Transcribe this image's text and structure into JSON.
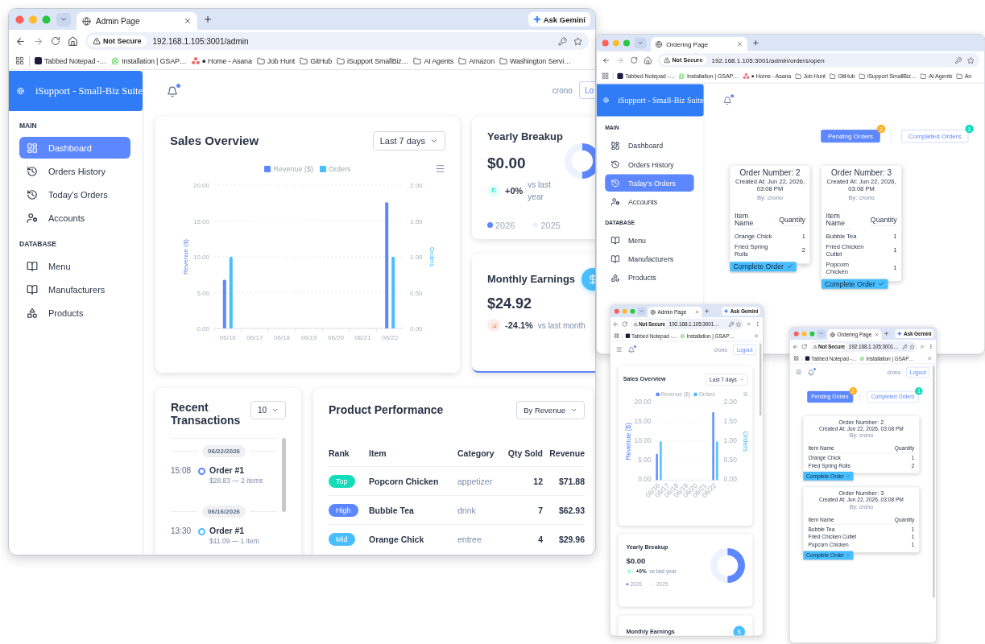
{
  "admin_window": {
    "browser": {
      "tab_title": "Admin Page",
      "assistant": "Ask Gemini",
      "security": "Not Secure",
      "url": "192.168.1.105:3001/admin",
      "bookmarks": [
        {
          "label": "Tabbed Notepad -…",
          "kind": "notepad"
        },
        {
          "label": "Installation | GSAP…",
          "kind": "gsap"
        },
        {
          "label": "● Home - Asana",
          "kind": "asana"
        },
        {
          "label": "Job Hunt",
          "kind": "folder"
        },
        {
          "label": "GitHub",
          "kind": "folder"
        },
        {
          "label": "iSupport SmallBiz…",
          "kind": "folder"
        },
        {
          "label": "AI Agents",
          "kind": "folder"
        },
        {
          "label": "Amazon",
          "kind": "folder"
        },
        {
          "label": "Washington Servi…",
          "kind": "folder"
        }
      ]
    },
    "sidebar": {
      "brand": "iSupport - Small-Biz Suite",
      "sections": [
        {
          "title": "MAIN",
          "items": [
            {
              "label": "Dashboard",
              "kind": "dashboard",
              "selected": true
            },
            {
              "label": "Orders History",
              "kind": "history",
              "selected": false
            },
            {
              "label": "Today's Orders",
              "kind": "history",
              "selected": false
            },
            {
              "label": "Accounts",
              "kind": "accounts",
              "selected": false
            }
          ]
        },
        {
          "title": "DATABASE",
          "items": [
            {
              "label": "Menu",
              "kind": "book",
              "selected": false
            },
            {
              "label": "Manufacturers",
              "kind": "book",
              "selected": false
            },
            {
              "label": "Products",
              "kind": "shapes",
              "selected": false
            }
          ]
        }
      ]
    },
    "header": {
      "user": "crono",
      "logout": "Lo"
    },
    "sales_overview": {
      "title": "Sales Overview",
      "range": "Last 7 days",
      "chart_data": {
        "type": "bar",
        "grid": true,
        "categories": [
          "06/16",
          "06/17",
          "06/18",
          "06/19",
          "06/20",
          "06/21",
          "06/22"
        ],
        "series": [
          {
            "name": "Revenue ($)",
            "color": "#5d87ff",
            "values": [
              6.8,
              0,
              0,
              0,
              0,
              0,
              17.6
            ]
          },
          {
            "name": "Orders",
            "color": "#49beff",
            "axis": "y2",
            "values": [
              1,
              0,
              0,
              0,
              0,
              0,
              1
            ]
          }
        ],
        "ylabel": "Revenue ($)",
        "ylim": [
          0,
          20
        ],
        "yticks": [
          {
            "value": 0,
            "label": "0.00"
          },
          {
            "value": 5,
            "label": "5.00"
          },
          {
            "value": 10,
            "label": "10.00"
          },
          {
            "value": 15,
            "label": "15.00"
          },
          {
            "value": 20,
            "label": "20.00"
          }
        ],
        "y2label": "Orders",
        "y2lim": [
          0,
          2
        ],
        "y2ticks": [
          {
            "value": 0,
            "label": "0.00"
          },
          {
            "value": 0.5,
            "label": "0.50"
          },
          {
            "value": 1,
            "label": "1.00"
          },
          {
            "value": 1.5,
            "label": "1.50"
          },
          {
            "value": 2,
            "label": "2.00"
          }
        ]
      }
    },
    "yearly_breakup": {
      "title": "Yearly Breakup",
      "amount": "$0.00",
      "change": "+0%",
      "comparison": "vs last year",
      "rising": true,
      "legend": [
        {
          "label": "2026",
          "color": "#5d87ff"
        },
        {
          "label": "2025",
          "color": "#ecf2ff"
        }
      ]
    },
    "monthly_earnings": {
      "title": "Monthly Earnings",
      "amount": "$24.92",
      "change": "-24.1%",
      "comparison": "vs last month",
      "rising": false
    },
    "recent_transactions": {
      "title": "Recent Transactions",
      "count": "10",
      "groups": [
        {
          "date": "06/22/2026",
          "entries": [
            {
              "time": "15:08",
              "title": "Order #1",
              "detail": "$28.83 — 2 items",
              "color": "#5d87ff"
            }
          ]
        },
        {
          "date": "06/16/2026",
          "entries": [
            {
              "time": "13:30",
              "title": "Order #1",
              "detail": "$11.09 — 1 item",
              "color": "#49beff"
            }
          ]
        }
      ]
    },
    "product_performance": {
      "title": "Product Performance",
      "sort": "By Revenue",
      "columns": [
        "Rank",
        "Item",
        "Category",
        "Qty Sold",
        "Revenue"
      ],
      "rows": [
        {
          "rank": "Top",
          "color": "#13deb9",
          "item": "Popcorn Chicken",
          "category": "appetizer",
          "qty": "12",
          "revenue": "$71.88"
        },
        {
          "rank": "High",
          "color": "#5d87ff",
          "item": "Bubble Tea",
          "category": "drink",
          "qty": "7",
          "revenue": "$62.93"
        },
        {
          "rank": "Mid",
          "color": "#49beff",
          "item": "Orange Chick",
          "category": "entree",
          "qty": "4",
          "revenue": "$29.96"
        }
      ]
    }
  },
  "ordering_window": {
    "browser": {
      "tab_title": "Ordering Page",
      "security": "Not Secure",
      "url": "192.168.1.105:3001/admin/orders/open",
      "bookmarks": [
        {
          "label": "Tabbed Notepad -…",
          "kind": "notepad"
        },
        {
          "label": "Installation | GSAP…",
          "kind": "gsap"
        },
        {
          "label": "● Home - Asana",
          "kind": "asana"
        },
        {
          "label": "Job Hunt",
          "kind": "folder"
        },
        {
          "label": "GitHub",
          "kind": "folder"
        },
        {
          "label": "iSupport SmallBiz…",
          "kind": "folder"
        },
        {
          "label": "AI Agents",
          "kind": "folder"
        },
        {
          "label": "An",
          "kind": "folder"
        }
      ]
    },
    "sidebar": {
      "brand": "iSupport - Small-Biz Suite",
      "sections": [
        {
          "title": "MAIN",
          "items": [
            {
              "label": "Dashboard",
              "kind": "dashboard",
              "selected": false
            },
            {
              "label": "Orders History",
              "kind": "history",
              "selected": false
            },
            {
              "label": "Today's Orders",
              "kind": "history",
              "selected": true
            },
            {
              "label": "Accounts",
              "kind": "accounts",
              "selected": false
            }
          ]
        },
        {
          "title": "DATABASE",
          "items": [
            {
              "label": "Menu",
              "kind": "book",
              "selected": false
            },
            {
              "label": "Manufacturers",
              "kind": "book",
              "selected": false
            },
            {
              "label": "Products",
              "kind": "shapes",
              "selected": false
            }
          ]
        }
      ]
    },
    "order_tabs": [
      {
        "label": "Pending Orders",
        "count": "2",
        "color": "#ffae1f",
        "selected": true
      },
      {
        "label": "Completed Orders",
        "count": "1",
        "color": "#13deb9",
        "selected": false
      }
    ],
    "orders": [
      {
        "title": "Order Number: 2",
        "created": "Created At: Jun 22, 2026, 03:08 PM",
        "by": "By: crono",
        "columns": [
          "Item Name",
          "Quantity"
        ],
        "items": [
          {
            "name": "Orange Chick",
            "qty": "1"
          },
          {
            "name": "Fried Spring Rolls",
            "qty": "2"
          }
        ],
        "action": "Complete Order"
      },
      {
        "title": "Order Number: 3",
        "created": "Created At: Jun 22, 2026, 03:08 PM",
        "by": "By: crono",
        "columns": [
          "Item Name",
          "Quantity"
        ],
        "items": [
          {
            "name": "Bubble Tea",
            "qty": "1"
          },
          {
            "name": "Fried Chicken Cutlet",
            "qty": "1"
          },
          {
            "name": "Popcorn Chicken",
            "qty": "1"
          }
        ],
        "action": "Complete Order"
      }
    ]
  },
  "mobile_admin_window": {
    "browser": {
      "tab_title": "Admin Page",
      "assistant": "Ask Gemini",
      "security": "Not Secure",
      "url": "192.168.1.105:3001…",
      "bookmarks": [
        {
          "label": "Tabbed Notepad -…",
          "kind": "notepad"
        },
        {
          "label": "Installation | GSAP…",
          "kind": "gsap"
        }
      ]
    },
    "header": {
      "user": "crono",
      "logout": "Logout"
    },
    "sales_overview": {
      "title": "Sales Overview",
      "range": "Last 7 days",
      "chart_data": {
        "type": "bar",
        "grid": true,
        "categories": [
          "06/16",
          "06/17",
          "06/18",
          "06/19",
          "06/20",
          "06/21",
          "06/22"
        ],
        "series": [
          {
            "name": "Revenue ($)",
            "color": "#5d87ff",
            "values": [
              6.8,
              0,
              0,
              0,
              0,
              0,
              17.6
            ]
          },
          {
            "name": "Orders",
            "color": "#49beff",
            "axis": "y2",
            "values": [
              1,
              0,
              0,
              0,
              0,
              0,
              1
            ]
          }
        ],
        "ylabel": "Revenue ($)",
        "ylim": [
          0,
          20
        ],
        "yticks": [
          {
            "value": 0,
            "label": "0.00"
          },
          {
            "value": 5,
            "label": "5.00"
          },
          {
            "value": 10,
            "label": "10.00"
          },
          {
            "value": 15,
            "label": "15.00"
          },
          {
            "value": 20,
            "label": "20.00"
          }
        ],
        "y2label": "Orders",
        "y2lim": [
          0,
          2
        ],
        "y2ticks": [
          {
            "value": 0,
            "label": "0.00"
          },
          {
            "value": 0.5,
            "label": "0.50"
          },
          {
            "value": 1,
            "label": "1.00"
          },
          {
            "value": 1.5,
            "label": "1.50"
          },
          {
            "value": 2,
            "label": "2.00"
          }
        ]
      }
    },
    "yearly_breakup": {
      "title": "Yearly Breakup",
      "amount": "$0.00",
      "change": "+0%",
      "comparison": "vs last year",
      "rising": true,
      "legend": [
        {
          "label": "2026",
          "color": "#5d87ff"
        },
        {
          "label": "2025",
          "color": "#ecf2ff"
        }
      ]
    },
    "monthly_earnings": {
      "title": "Monthly Earnings"
    }
  },
  "mobile_ordering_window": {
    "browser": {
      "tab_title": "Ordering Page",
      "assistant": "Ask Gemini",
      "security": "Not Secure",
      "url": "192.168.1.105:3001…",
      "bookmarks": [
        {
          "label": "Tabbed Notepad -…",
          "kind": "notepad"
        },
        {
          "label": "Installation | GSAP…",
          "kind": "gsap"
        }
      ]
    },
    "header": {
      "user": "crono",
      "logout": "Logout"
    },
    "order_tabs": [
      {
        "label": "Pending Orders",
        "count": "2",
        "color": "#ffae1f",
        "selected": true
      },
      {
        "label": "Completed Orders",
        "count": "1",
        "color": "#13deb9",
        "selected": false
      }
    ],
    "orders": [
      {
        "title": "Order Number: 2",
        "created": "Created At: Jun 22, 2026, 03:08 PM",
        "by": "By: crono",
        "columns": [
          "Item Name",
          "Quantity"
        ],
        "items": [
          {
            "name": "Orange Chick",
            "qty": "1"
          },
          {
            "name": "Fried Spring Rolls",
            "qty": "2"
          }
        ],
        "action": "Complete Order"
      },
      {
        "title": "Order Number: 3",
        "created": "Created At: Jun 22, 2026, 03:08 PM",
        "by": "By: crono",
        "columns": [
          "Item Name",
          "Quantity"
        ],
        "items": [
          {
            "name": "Bubble Tea",
            "qty": "1"
          },
          {
            "name": "Fried Chicken Cutlet",
            "qty": "1"
          },
          {
            "name": "Popcorn Chicken",
            "qty": "1"
          }
        ],
        "action": "Complete Order"
      }
    ]
  }
}
